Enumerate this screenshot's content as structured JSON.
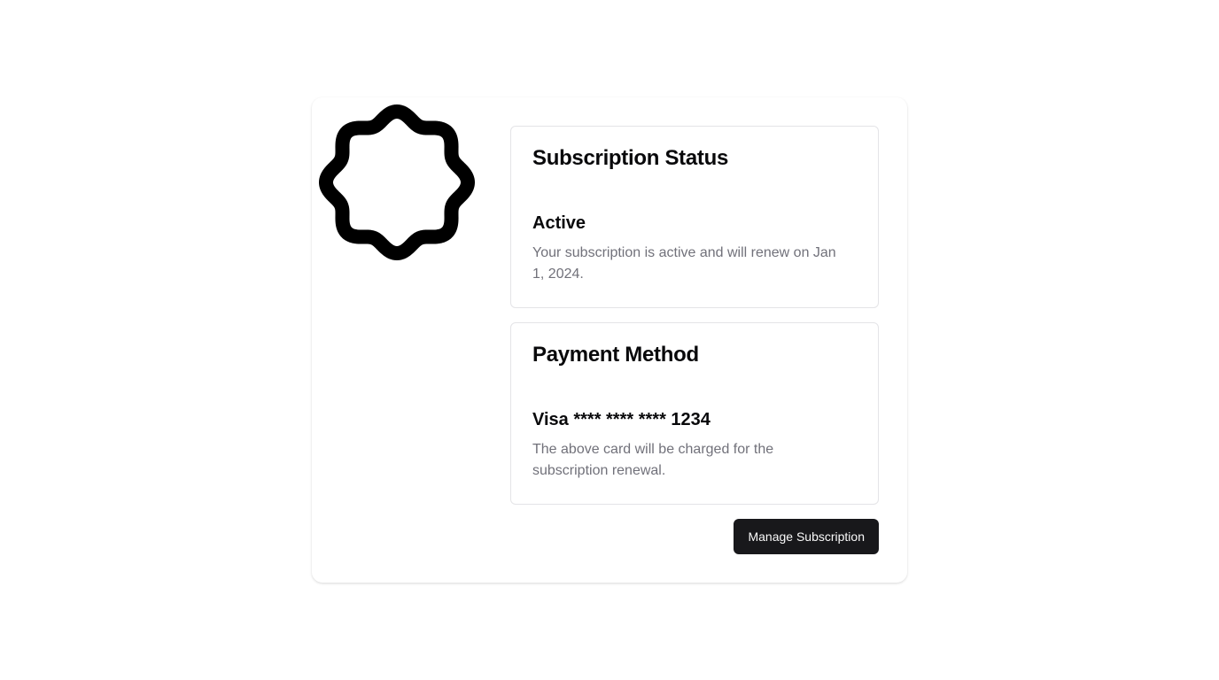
{
  "logo": {
    "icon": "scalloped-badge-icon",
    "color": "#000000"
  },
  "subscription": {
    "title": "Subscription Status",
    "status": "Active",
    "description": "Your subscription is active and will renew on Jan 1, 2024."
  },
  "payment": {
    "title": "Payment Method",
    "card": "Visa **** **** **** 1234",
    "description": "The above card will be charged for the subscription renewal."
  },
  "actions": {
    "manage_label": "Manage Subscription"
  },
  "colors": {
    "button_bg": "#18181b",
    "muted_text": "#71717a",
    "border": "#e4e4e7"
  }
}
